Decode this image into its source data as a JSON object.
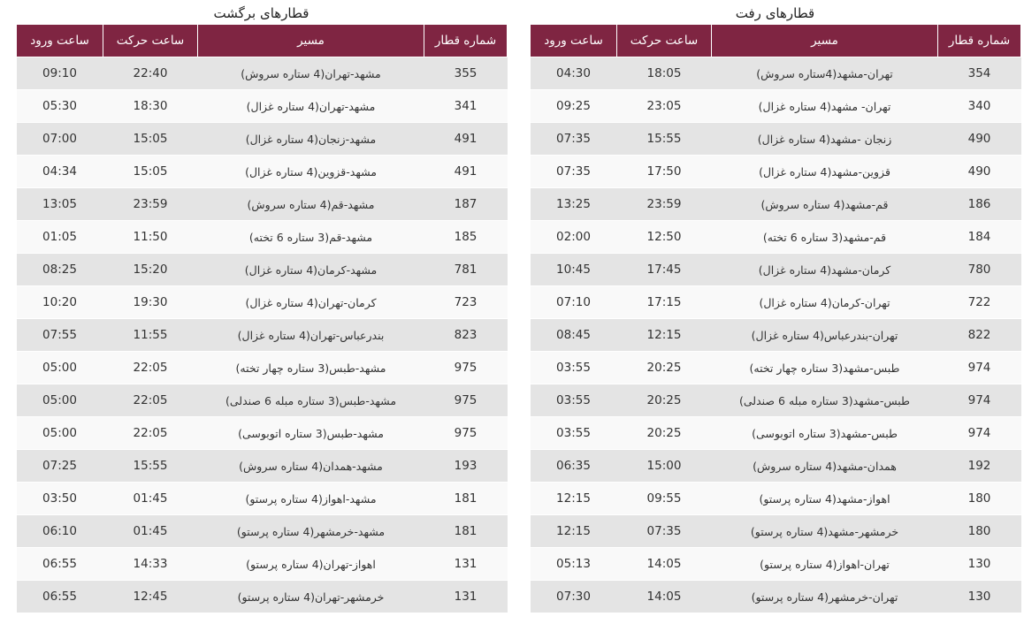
{
  "headers": {
    "train_number": "شماره قطار",
    "route": "مسیر",
    "departure": "ساعت حرکت",
    "arrival": "ساعت ورود"
  },
  "outbound": {
    "title": "قطارهای رفت",
    "rows": [
      {
        "train": "354",
        "route": "تهران-مشهد(4ستاره سروش)",
        "departure": "18:05",
        "arrival": "04:30"
      },
      {
        "train": "340",
        "route": "تهران- مشهد(4 ستاره غزال)",
        "departure": "23:05",
        "arrival": "09:25"
      },
      {
        "train": "490",
        "route": "زنجان -مشهد(4 ستاره غزال)",
        "departure": "15:55",
        "arrival": "07:35"
      },
      {
        "train": "490",
        "route": "قزوین-مشهد(4 ستاره غزال)",
        "departure": "17:50",
        "arrival": "07:35"
      },
      {
        "train": "186",
        "route": "قم-مشهد(4 ستاره سروش)",
        "departure": "23:59",
        "arrival": "13:25"
      },
      {
        "train": "184",
        "route": "قم-مشهد(3 ستاره 6 تخته)",
        "departure": "12:50",
        "arrival": "02:00"
      },
      {
        "train": "780",
        "route": "کرمان-مشهد(4 ستاره غزال)",
        "departure": "17:45",
        "arrival": "10:45"
      },
      {
        "train": "722",
        "route": "تهران-کرمان(4 ستاره غزال)",
        "departure": "17:15",
        "arrival": "07:10"
      },
      {
        "train": "822",
        "route": "تهران-بندرعباس(4 ستاره غزال)",
        "departure": "12:15",
        "arrival": "08:45"
      },
      {
        "train": "974",
        "route": "طبس-مشهد(3 ستاره چهار تخته)",
        "departure": "20:25",
        "arrival": "03:55"
      },
      {
        "train": "974",
        "route": "طبس-مشهد(3 ستاره مبله 6 صندلی)",
        "departure": "20:25",
        "arrival": "03:55"
      },
      {
        "train": "974",
        "route": "طبس-مشهد(3 ستاره اتوبوسی)",
        "departure": "20:25",
        "arrival": "03:55"
      },
      {
        "train": "192",
        "route": "همدان-مشهد(4 ستاره سروش)",
        "departure": "15:00",
        "arrival": "06:35"
      },
      {
        "train": "180",
        "route": "اهواز-مشهد(4 ستاره پرستو)",
        "departure": "09:55",
        "arrival": "12:15"
      },
      {
        "train": "180",
        "route": "خرمشهر-مشهد(4 ستاره پرستو)",
        "departure": "07:35",
        "arrival": "12:15"
      },
      {
        "train": "130",
        "route": "تهران-اهواز(4 ستاره پرستو)",
        "departure": "14:05",
        "arrival": "05:13"
      },
      {
        "train": "130",
        "route": "تهران-خرمشهر(4 ستاره پرستو)",
        "departure": "14:05",
        "arrival": "07:30"
      }
    ]
  },
  "return": {
    "title": "قطارهای برگشت",
    "rows": [
      {
        "train": "355",
        "route": "مشهد-تهران(4 ستاره سروش)",
        "departure": "22:40",
        "arrival": "09:10"
      },
      {
        "train": "341",
        "route": "مشهد-تهران(4 ستاره غزال)",
        "departure": "18:30",
        "arrival": "05:30"
      },
      {
        "train": "491",
        "route": "مشهد-زنجان(4 ستاره غزال)",
        "departure": "15:05",
        "arrival": "07:00"
      },
      {
        "train": "491",
        "route": "مشهد-قزوین(4 ستاره غزال)",
        "departure": "15:05",
        "arrival": "04:34"
      },
      {
        "train": "187",
        "route": "مشهد-قم(4 ستاره سروش)",
        "departure": "23:59",
        "arrival": "13:05"
      },
      {
        "train": "185",
        "route": "مشهد-قم(3 ستاره 6 تخته)",
        "departure": "11:50",
        "arrival": "01:05"
      },
      {
        "train": "781",
        "route": "مشهد-کرمان(4 ستاره غزال)",
        "departure": "15:20",
        "arrival": "08:25"
      },
      {
        "train": "723",
        "route": "کرمان-تهران(4 ستاره غزال)",
        "departure": "19:30",
        "arrival": "10:20"
      },
      {
        "train": "823",
        "route": "بندرعباس-تهران(4 ستاره غزال)",
        "departure": "11:55",
        "arrival": "07:55"
      },
      {
        "train": "975",
        "route": "مشهد-طبس(3 ستاره چهار تخته)",
        "departure": "22:05",
        "arrival": "05:00"
      },
      {
        "train": "975",
        "route": "مشهد-طبس(3 ستاره مبله 6 صندلی)",
        "departure": "22:05",
        "arrival": "05:00"
      },
      {
        "train": "975",
        "route": "مشهد-طبس(3 ستاره اتوبوسی)",
        "departure": "22:05",
        "arrival": "05:00"
      },
      {
        "train": "193",
        "route": "مشهد-همدان(4 ستاره سروش)",
        "departure": "15:55",
        "arrival": "07:25"
      },
      {
        "train": "181",
        "route": "مشهد-اهواز(4 ستاره پرستو)",
        "departure": "01:45",
        "arrival": "03:50"
      },
      {
        "train": "181",
        "route": "مشهد-خرمشهر(4 ستاره پرستو)",
        "departure": "01:45",
        "arrival": "06:10"
      },
      {
        "train": "131",
        "route": "اهواز-تهران(4 ستاره پرستو)",
        "departure": "14:33",
        "arrival": "06:55"
      },
      {
        "train": "131",
        "route": "خرمشهر-تهران(4 ستاره پرستو)",
        "departure": "12:45",
        "arrival": "06:55"
      }
    ]
  },
  "colors": {
    "header_background": "#7f2542",
    "header_text": "#ffffff",
    "row_odd": "#e4e4e4",
    "row_even": "#f9f9f9"
  }
}
